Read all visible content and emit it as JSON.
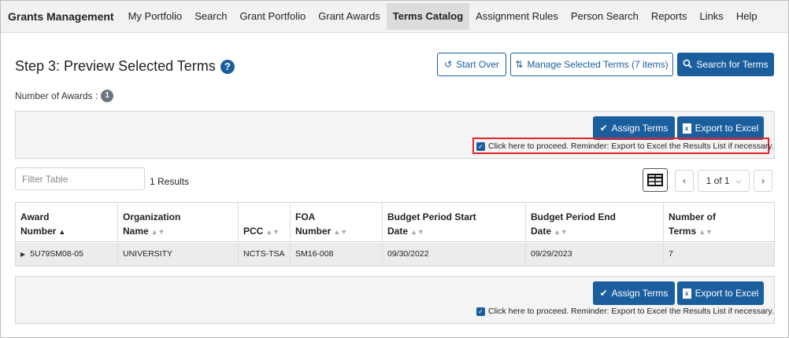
{
  "nav": {
    "brand": "Grants Management",
    "items": [
      {
        "label": "My Portfolio",
        "active": false
      },
      {
        "label": "Search",
        "active": false
      },
      {
        "label": "Grant Portfolio",
        "active": false
      },
      {
        "label": "Grant Awards",
        "active": false
      },
      {
        "label": "Terms Catalog",
        "active": true
      },
      {
        "label": "Assignment Rules",
        "active": false
      },
      {
        "label": "Person Search",
        "active": false
      },
      {
        "label": "Reports",
        "active": false
      },
      {
        "label": "Links",
        "active": false
      },
      {
        "label": "Help",
        "active": false
      }
    ]
  },
  "header": {
    "title": "Step 3: Preview Selected Terms",
    "help_icon": "?",
    "awards_label": "Number of Awards :",
    "awards_count": "1",
    "start_over_label": "Start Over",
    "manage_terms_label": "Manage Selected Terms (7 items)",
    "search_terms_label": "Search for Terms"
  },
  "actions": {
    "assign_label": "Assign Terms",
    "export_label": "Export to Excel",
    "excel_icon_text": "x",
    "proceed_label": "Click here to proceed. Reminder: Export to Excel the Results List if necessary."
  },
  "controls": {
    "filter_placeholder": "Filter Table",
    "results_text": "1 Results",
    "pager_text": "1 of 1"
  },
  "table": {
    "columns": [
      {
        "line1": "Award",
        "line2": "Number",
        "sort": "asc"
      },
      {
        "line1": "Organization",
        "line2": "Name",
        "sort": "none"
      },
      {
        "line1": "",
        "line2": "PCC",
        "sort": "none"
      },
      {
        "line1": "FOA",
        "line2": "Number",
        "sort": "none"
      },
      {
        "line1": "Budget Period Start",
        "line2": "Date",
        "sort": "none"
      },
      {
        "line1": "Budget Period End",
        "line2": "Date",
        "sort": "none"
      },
      {
        "line1": "Number of",
        "line2": "Terms",
        "sort": "none"
      }
    ],
    "rows": [
      [
        "5U79SM08-05",
        "UNIVERSITY",
        "NCTS-TSA",
        "SM16-008",
        "09/30/2022",
        "09/29/2023",
        "7"
      ]
    ]
  },
  "colors": {
    "primary": "#1b5e9e",
    "highlight": "#e2232a"
  }
}
